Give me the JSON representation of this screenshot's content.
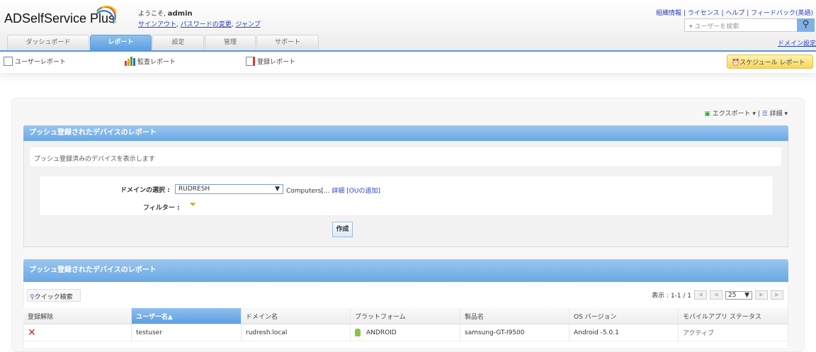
{
  "header": {
    "logo": "ADSelfService Plus",
    "welcome": "ようこそ,",
    "user": "admin",
    "links": [
      "サインアウト",
      "パスワードの変更",
      "ジャンプ"
    ],
    "top_links": [
      "組織情報",
      "ライセンス",
      "ヘルプ",
      "フィードバック(英語)"
    ],
    "search_placeholder": "ユーザーを検索",
    "domain_settings": "ドメイン設定"
  },
  "tabs": [
    "ダッシュボード",
    "レポート",
    "設定",
    "管理",
    "サポート"
  ],
  "subnav": [
    "ユーザーレポート",
    "監査レポート",
    "登録レポート"
  ],
  "schedule": "スケジュール レポート",
  "toolbar": {
    "export": "エクスポート",
    "details": "詳細"
  },
  "panel": {
    "title": "プッシュ登録されたデバイスのレポート",
    "description": "プッシュ登録済みのデバイスを表示します",
    "domain_label": "ドメインの選択 :",
    "domain_value": "RUDRESH",
    "ou": "Computers[...",
    "detail_link": "詳細",
    "add_ou": "[OUの追加]",
    "filter_label": "フィルター :",
    "create": "作成"
  },
  "results": {
    "title": "プッシュ登録されたデバイスのレポート",
    "quick_search": "クイック検索",
    "paging": "表示 : 1-1 / 1",
    "page_size": "25",
    "columns": [
      "登録解除",
      "ユーザー名▲",
      "ドメイン名",
      "プラットフォーム",
      "製品名",
      "OS バージョン",
      "モバイルアプリ ステータス"
    ],
    "rows": [
      {
        "user": "testuser",
        "domain": "rudresh.local",
        "platform": "ANDROID",
        "product": "samsung-GT-I9500",
        "os": "Android -5.0.1",
        "status": "アクティブ"
      }
    ]
  },
  "colors": {
    "accent": "#5c9ee0",
    "link": "#2a3fbf"
  }
}
